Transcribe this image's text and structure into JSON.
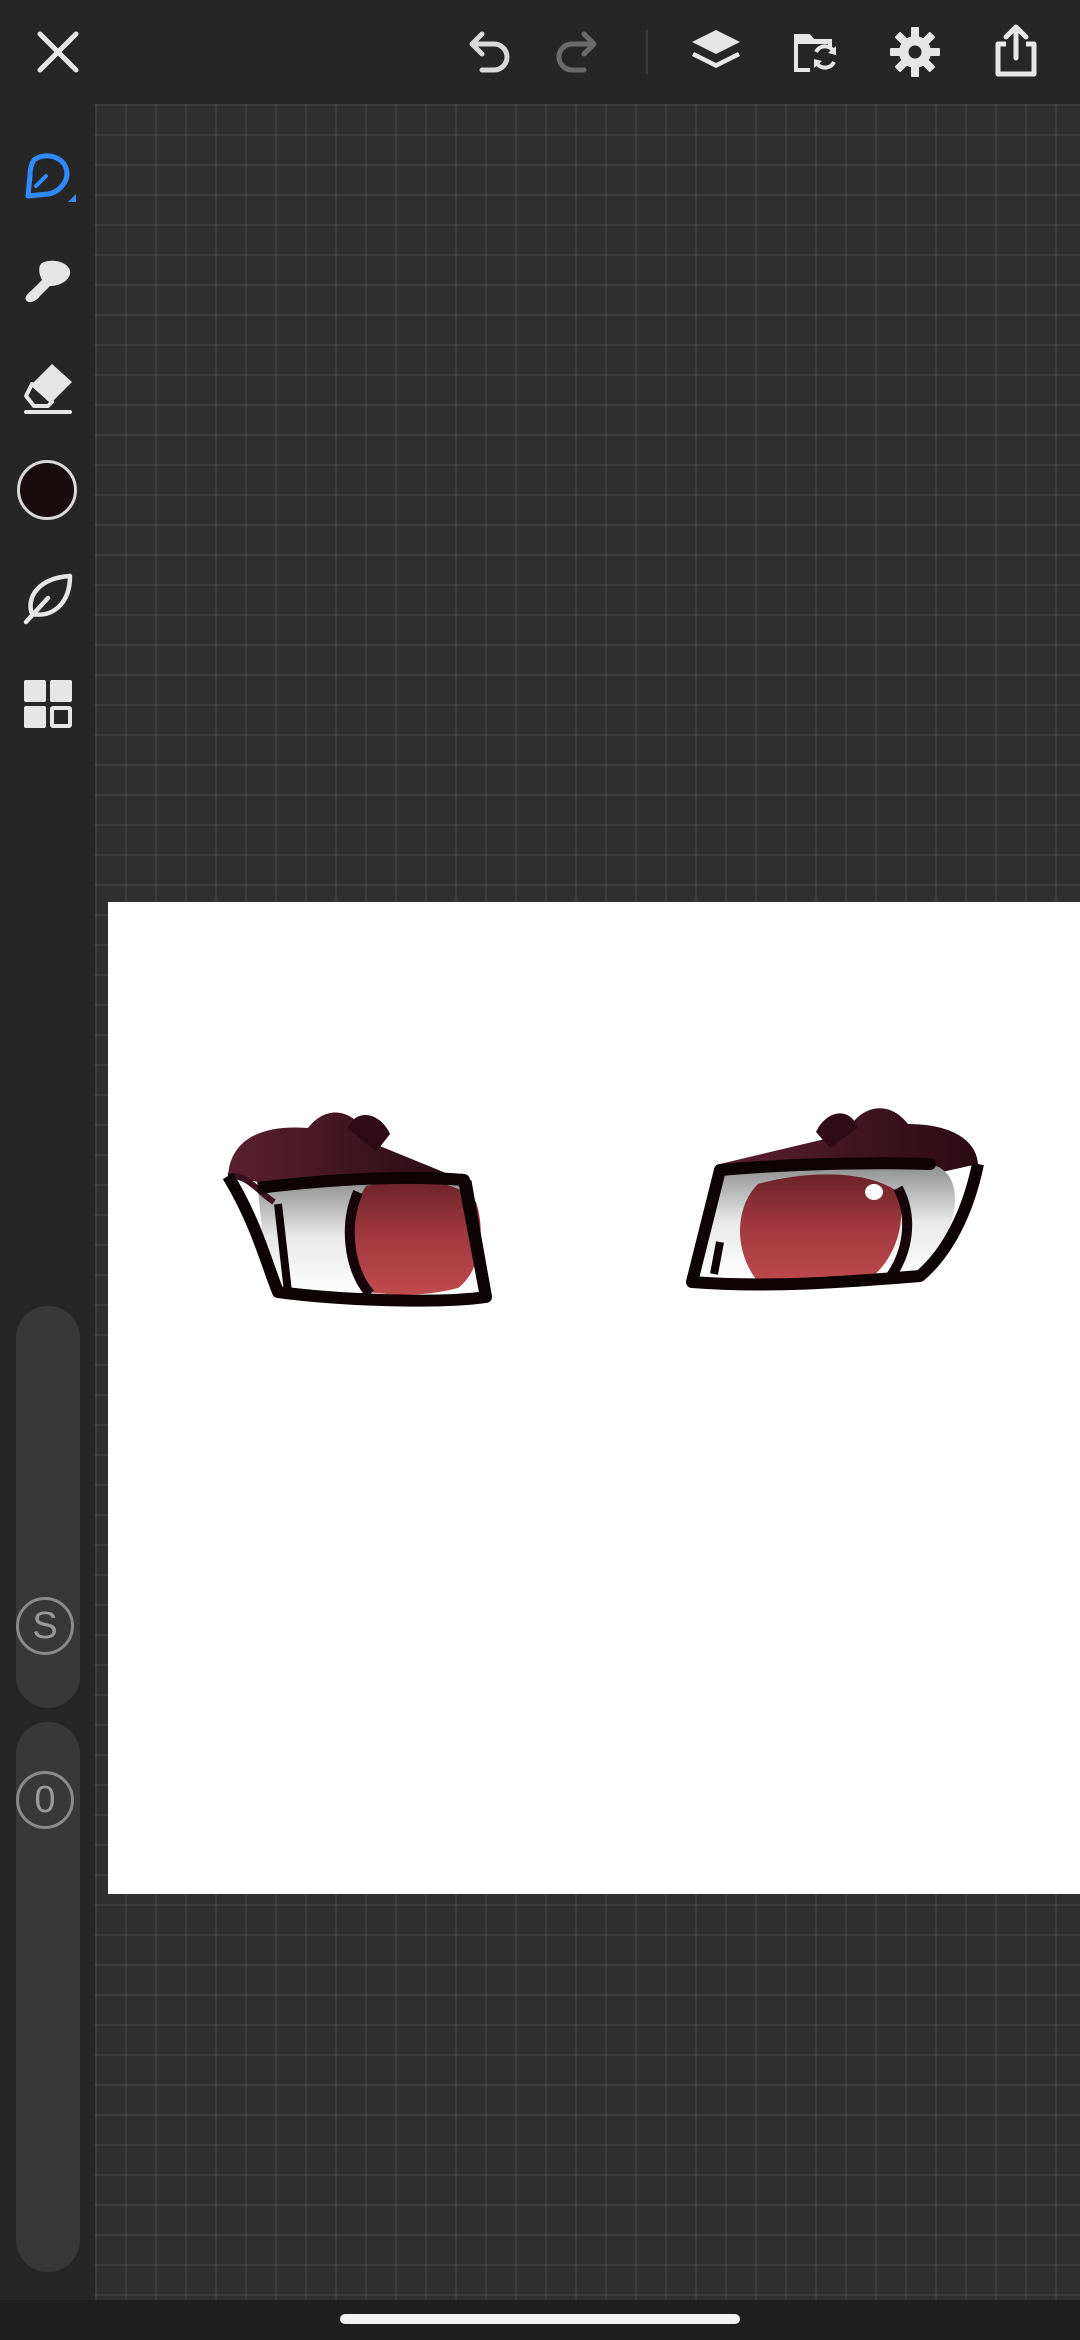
{
  "toolbar": {
    "close": "close-icon",
    "undo": "undo-icon",
    "redo": "redo-icon",
    "layers": "layers-icon",
    "material": "folder-sync-icon",
    "settings": "gear-icon",
    "share": "share-icon"
  },
  "sidebar": {
    "tools": [
      "pen-icon",
      "brush-icon",
      "eraser-icon",
      "color-swatch",
      "leaf-icon",
      "materials-grid-icon"
    ],
    "active_tool": "pen-icon",
    "current_color": "#1a0d10",
    "size_slider_label": "S",
    "opacity_slider_label": "0"
  },
  "colors": {
    "accent": "#2f8cff",
    "toolbar_bg": "#262626",
    "workspace_bg": "#2f2f2f",
    "canvas_bg": "#ffffff",
    "eye_iris": "#b3454a",
    "eye_lash": "#3a1020"
  }
}
